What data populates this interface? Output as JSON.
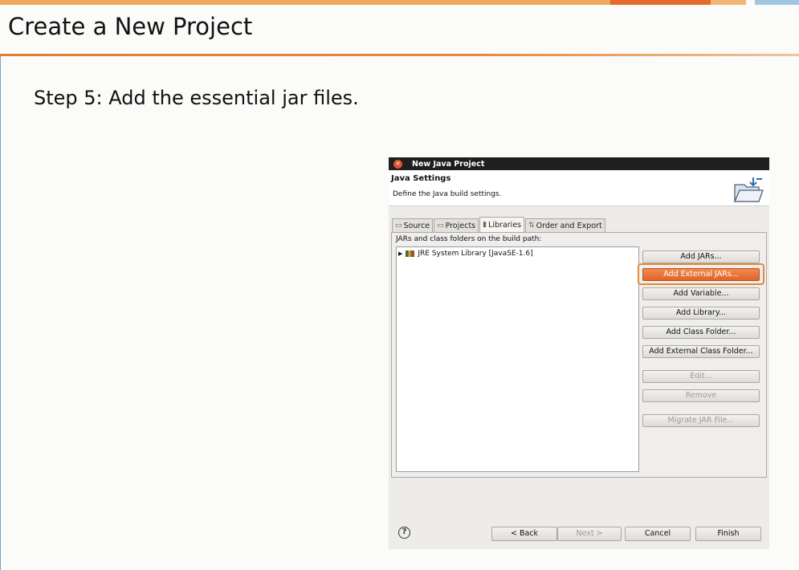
{
  "slide": {
    "title": "Create a New Project",
    "step": "Step 5: Add the essential jar files."
  },
  "dialog": {
    "window_title": "New Java Project",
    "header_title": "Java Settings",
    "header_subtitle": "Define the Java build settings.",
    "tabs": [
      {
        "label": "Source",
        "icon": "source-folder-icon"
      },
      {
        "label": "Projects",
        "icon": "projects-icon"
      },
      {
        "label": "Libraries",
        "icon": "libraries-icon"
      },
      {
        "label": "Order and Export",
        "icon": "order-icon"
      }
    ],
    "active_tab": "Libraries",
    "build_path_label": "JARs and class folders on the build path:",
    "tree_items": [
      {
        "label": "JRE System Library [JavaSE-1.6]"
      }
    ],
    "buttons": {
      "add_jars": "Add JARs...",
      "add_external_jars": "Add External JARs...",
      "add_variable": "Add Variable...",
      "add_library": "Add Library...",
      "add_class_folder": "Add Class Folder...",
      "add_external_class_folder": "Add External Class Folder...",
      "edit": "Edit...",
      "remove": "Remove",
      "migrate_jar": "Migrate JAR File..."
    },
    "footer": {
      "help": "?",
      "back": "< Back",
      "next": "Next >",
      "cancel": "Cancel",
      "finish": "Finish"
    }
  }
}
